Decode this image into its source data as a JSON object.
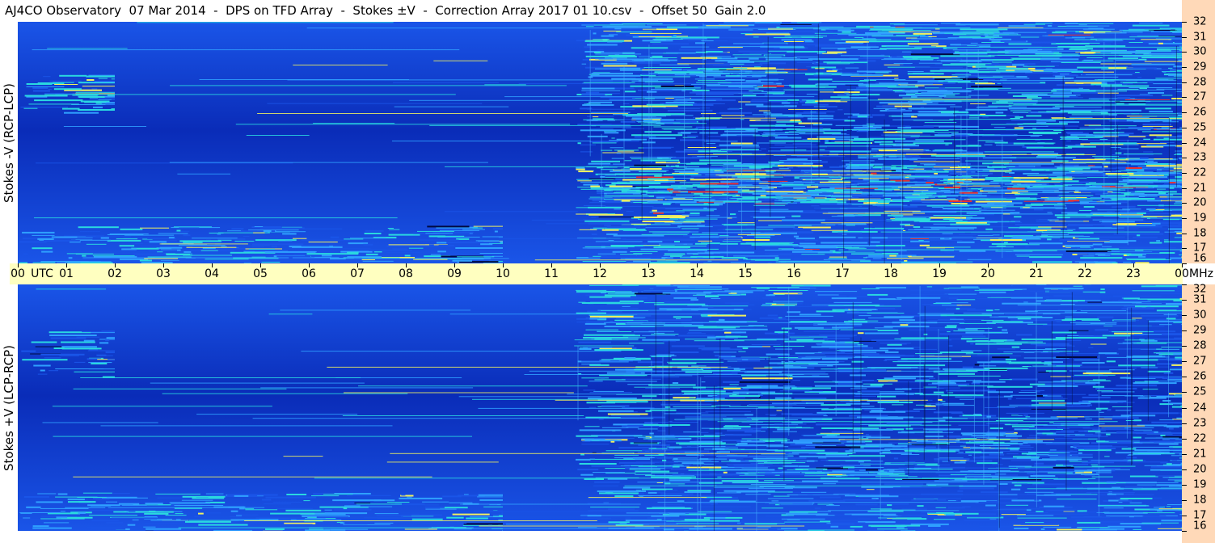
{
  "title": "AJ4CO Observatory  07 Mar 2014  -  DPS on TFD Array  -  Stokes ±V  -  Correction Array 2017 01 10.csv  -  Offset 50  Gain 2.0",
  "colors": {
    "background_low": "#0a2cb8",
    "background_mid": "#1a55e8",
    "level_cyan": "#2ad8e0",
    "level_yellow": "#f0f060",
    "level_red": "#e83030",
    "axis_band": "#ffffc0",
    "scale_band": "#ffd9b8"
  },
  "chart_data": [
    {
      "type": "heatmap",
      "panel": "top",
      "ylabel": "Stokes -V (RCP-LCP)",
      "x_unit": "UTC",
      "y_unit": "MHz",
      "xlim": [
        0,
        24
      ],
      "ylim": [
        16,
        32
      ],
      "y_ticks": [
        "16",
        "17",
        "18",
        "19",
        "20",
        "21",
        "22",
        "23",
        "24",
        "25",
        "26",
        "27",
        "28",
        "29",
        "30",
        "31",
        "32"
      ],
      "activity": [
        {
          "t_start": 0.0,
          "t_end": 2.0,
          "f_lo": 26,
          "f_hi": 28.5,
          "level": 0.55
        },
        {
          "t_start": 0.0,
          "t_end": 10.0,
          "f_lo": 16,
          "f_hi": 18.5,
          "level": 0.5
        },
        {
          "t_start": 11.5,
          "t_end": 24.0,
          "f_lo": 16,
          "f_hi": 32,
          "level": 0.6
        },
        {
          "t_start": 12.0,
          "t_end": 24.0,
          "f_lo": 20,
          "f_hi": 22.5,
          "level": 0.75
        }
      ]
    },
    {
      "type": "heatmap",
      "panel": "bottom",
      "ylabel": "Stokes +V (LCP-RCP)",
      "x_unit": "UTC",
      "y_unit": "MHz",
      "xlim": [
        0,
        24
      ],
      "ylim": [
        16,
        32
      ],
      "y_ticks": [
        "16",
        "17",
        "18",
        "19",
        "20",
        "21",
        "22",
        "23",
        "24",
        "25",
        "26",
        "27",
        "28",
        "29",
        "30",
        "31",
        "32"
      ],
      "activity": [
        {
          "t_start": 0.0,
          "t_end": 2.0,
          "f_lo": 26,
          "f_hi": 29,
          "level": 0.4
        },
        {
          "t_start": 0.0,
          "t_end": 10.0,
          "f_lo": 16,
          "f_hi": 18.5,
          "level": 0.45
        },
        {
          "t_start": 11.5,
          "t_end": 24.0,
          "f_lo": 16,
          "f_hi": 32,
          "level": 0.45
        },
        {
          "t_start": 11.5,
          "t_end": 24.0,
          "f_lo": 19.5,
          "f_hi": 22.5,
          "level": 0.35
        }
      ]
    }
  ],
  "x_axis": {
    "ticks": [
      "00",
      "01",
      "02",
      "03",
      "04",
      "05",
      "06",
      "07",
      "08",
      "09",
      "10",
      "11",
      "12",
      "13",
      "14",
      "15",
      "16",
      "17",
      "18",
      "19",
      "20",
      "21",
      "22",
      "23",
      "00"
    ],
    "utc_label": "UTC",
    "mhz_label": "MHz"
  }
}
